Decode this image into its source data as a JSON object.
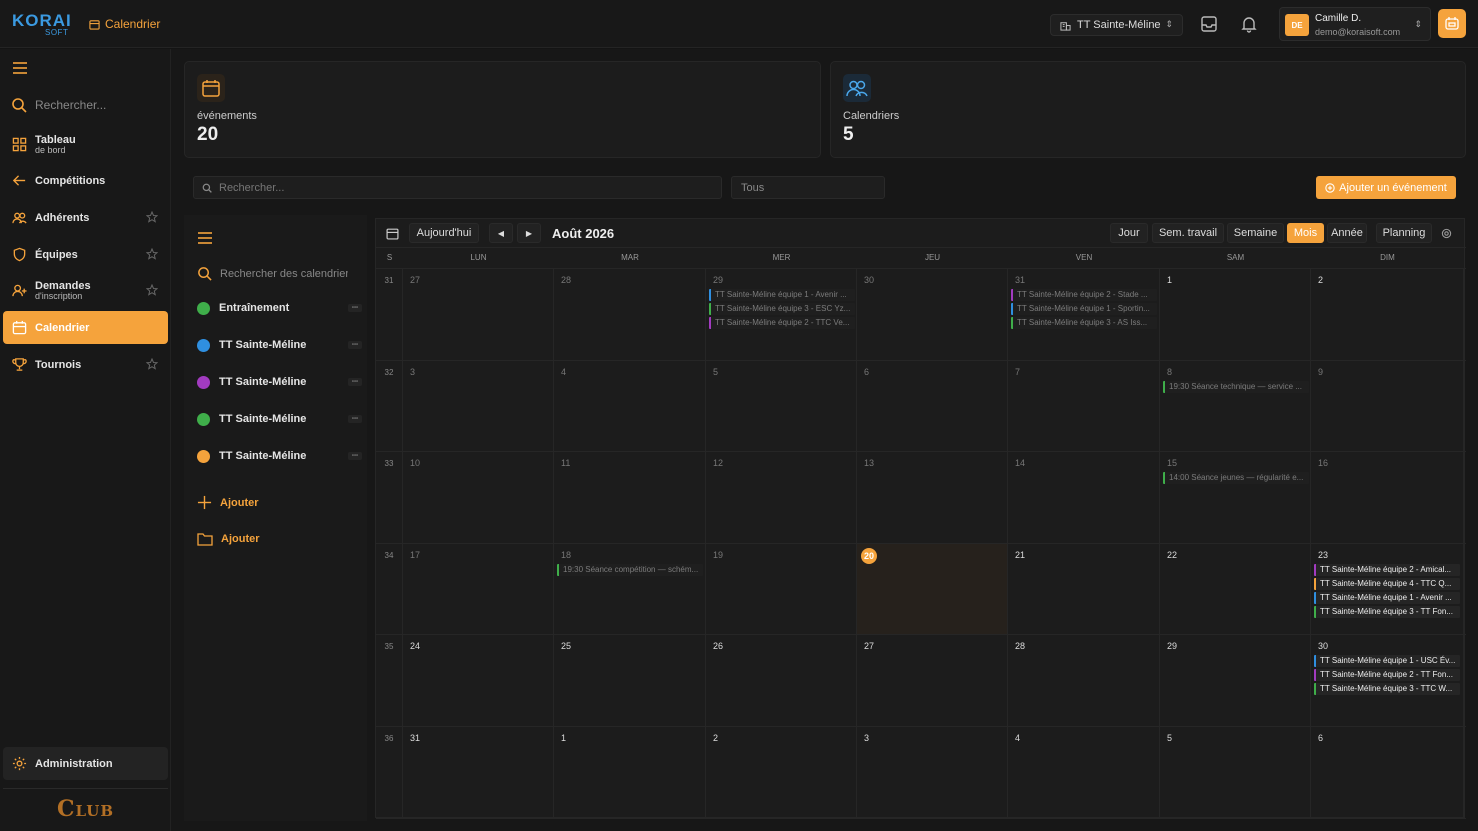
{
  "brand": {
    "name": "KORAI",
    "sub": "SOFT",
    "club_word": "Club"
  },
  "breadcrumb": "Calendrier",
  "club_select": "TT Sainte-Méline",
  "user": {
    "initials": "DE",
    "name": "Camille D.",
    "email": "demo@koraisoft.com"
  },
  "sidebar": {
    "search_placeholder": "Rechercher...",
    "items": [
      {
        "label": "Tableau",
        "sub": "de bord"
      },
      {
        "label": "Compétitions"
      },
      {
        "label": "Adhérents"
      },
      {
        "label": "Équipes"
      },
      {
        "label": "Demandes",
        "sub": "d'inscription"
      },
      {
        "label": "Calendrier"
      },
      {
        "label": "Tournois"
      }
    ],
    "admin": "Administration"
  },
  "stats": [
    {
      "label": "événements",
      "value": "20"
    },
    {
      "label": "Calendriers",
      "value": "5"
    }
  ],
  "search": {
    "placeholder": "Rechercher...",
    "filter": "Tous",
    "add_label": "Ajouter un événement"
  },
  "calendars": {
    "search_placeholder": "Rechercher des calendriers",
    "items": [
      {
        "name": "Entraînement",
        "color": "#3fae4a"
      },
      {
        "name": "TT Sainte-Méline",
        "color": "#2f8fe0"
      },
      {
        "name": "TT Sainte-Méline",
        "color": "#a23bc0"
      },
      {
        "name": "TT Sainte-Méline",
        "color": "#3fae4a"
      },
      {
        "name": "TT Sainte-Méline",
        "color": "#f5a33c"
      }
    ],
    "add_calendar": "Ajouter",
    "add_folder": "Ajouter"
  },
  "calendar": {
    "today_label": "Aujourd'hui",
    "title": "Août 2026",
    "views": [
      "Jour",
      "Sem. travail",
      "Semaine",
      "Mois",
      "Année",
      "Planning"
    ],
    "active_view": "Mois",
    "week_col": "S",
    "days": [
      "LUN",
      "MAR",
      "MER",
      "JEU",
      "VEN",
      "SAM",
      "DIM"
    ],
    "weeks": [
      {
        "num": "31",
        "dates": [
          "27",
          "28",
          "29",
          "30",
          "31",
          "1",
          "2"
        ],
        "muted": [
          true,
          true,
          true,
          true,
          true,
          false,
          false
        ]
      },
      {
        "num": "32",
        "dates": [
          "3",
          "4",
          "5",
          "6",
          "7",
          "8",
          "9"
        ],
        "muted": [
          true,
          true,
          true,
          true,
          true,
          true,
          true
        ]
      },
      {
        "num": "33",
        "dates": [
          "10",
          "11",
          "12",
          "13",
          "14",
          "15",
          "16"
        ],
        "muted": [
          true,
          true,
          true,
          true,
          true,
          true,
          true
        ]
      },
      {
        "num": "34",
        "dates": [
          "17",
          "18",
          "19",
          "20",
          "21",
          "22",
          "23"
        ],
        "muted": [
          true,
          true,
          true,
          false,
          false,
          false,
          false
        ]
      },
      {
        "num": "35",
        "dates": [
          "24",
          "25",
          "26",
          "27",
          "28",
          "29",
          "30"
        ],
        "muted": [
          false,
          false,
          false,
          false,
          false,
          false,
          false
        ]
      },
      {
        "num": "36",
        "dates": [
          "31",
          "1",
          "2",
          "3",
          "4",
          "5",
          "6"
        ],
        "muted": [
          false,
          false,
          false,
          false,
          false,
          false,
          false
        ]
      }
    ],
    "today": {
      "week": 3,
      "day": 3
    },
    "events": [
      {
        "week": 0,
        "day": 2,
        "text": "TT Sainte-Méline équipe 1 - Avenir ...",
        "color": "#2f8fe0",
        "dim": true
      },
      {
        "week": 0,
        "day": 2,
        "text": "TT Sainte-Méline équipe 3 - ESC Yz...",
        "color": "#3fae4a",
        "dim": true
      },
      {
        "week": 0,
        "day": 2,
        "text": "TT Sainte-Méline équipe 2 - TTC Ve...",
        "color": "#a23bc0",
        "dim": true
      },
      {
        "week": 0,
        "day": 4,
        "text": "TT Sainte-Méline équipe 2 - Stade ...",
        "color": "#a23bc0",
        "dim": true
      },
      {
        "week": 0,
        "day": 4,
        "text": "TT Sainte-Méline équipe 1 - Sportin...",
        "color": "#2f8fe0",
        "dim": true
      },
      {
        "week": 0,
        "day": 4,
        "text": "TT Sainte-Méline équipe 3 - AS Iss...",
        "color": "#3fae4a",
        "dim": true
      },
      {
        "week": 1,
        "day": 5,
        "text": "19:30 Séance technique — service ...",
        "color": "#3fae4a",
        "dim": true
      },
      {
        "week": 2,
        "day": 5,
        "text": "14:00 Séance jeunes — régularité e...",
        "color": "#3fae4a",
        "dim": true
      },
      {
        "week": 3,
        "day": 1,
        "text": "19:30 Séance compétition — schém...",
        "color": "#3fae4a",
        "dim": true
      },
      {
        "week": 3,
        "day": 6,
        "text": "TT Sainte-Méline équipe 2 - Amical...",
        "color": "#a23bc0",
        "dim": false
      },
      {
        "week": 3,
        "day": 6,
        "text": "TT Sainte-Méline équipe 4 - TTC Q...",
        "color": "#f5a33c",
        "dim": false
      },
      {
        "week": 3,
        "day": 6,
        "text": "TT Sainte-Méline équipe 1 - Avenir ...",
        "color": "#2f8fe0",
        "dim": false
      },
      {
        "week": 3,
        "day": 6,
        "text": "TT Sainte-Méline équipe 3 - TT Fon...",
        "color": "#3fae4a",
        "dim": false
      },
      {
        "week": 4,
        "day": 6,
        "text": "TT Sainte-Méline équipe 1 - USC Év...",
        "color": "#2f8fe0",
        "dim": false
      },
      {
        "week": 4,
        "day": 6,
        "text": "TT Sainte-Méline équipe 2 - TT Fon...",
        "color": "#a23bc0",
        "dim": false
      },
      {
        "week": 4,
        "day": 6,
        "text": "TT Sainte-Méline équipe 3 - TTC W...",
        "color": "#3fae4a",
        "dim": false
      }
    ]
  }
}
